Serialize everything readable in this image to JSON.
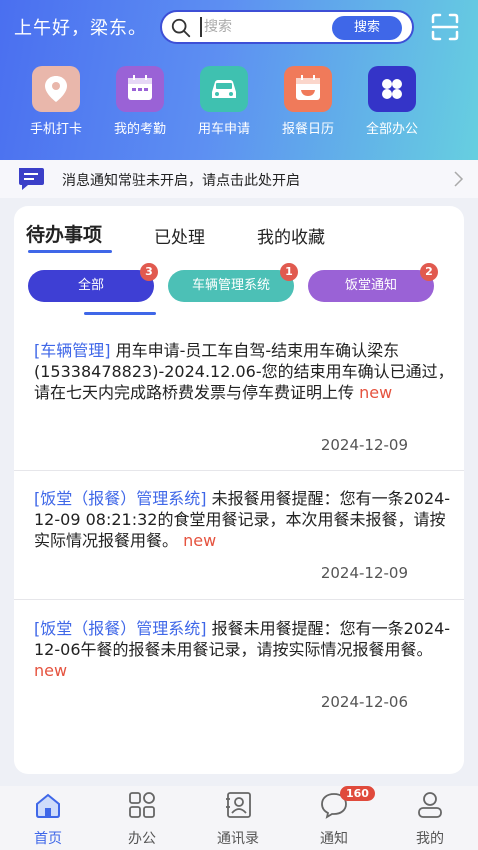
{
  "header": {
    "greeting": "上午好，梁东。",
    "search_placeholder": "搜索",
    "search_button": "搜索",
    "scan_icon": "scan-icon"
  },
  "quick_actions": [
    {
      "label": "手机打卡",
      "icon": "location-pin-icon",
      "color": "#e7b3a6"
    },
    {
      "label": "我的考勤",
      "icon": "calendar-icon",
      "color": "#9a62d6"
    },
    {
      "label": "用车申请",
      "icon": "car-icon",
      "color": "#3fc1b0"
    },
    {
      "label": "报餐日历",
      "icon": "meal-calendar-icon",
      "color": "#f07a5a"
    },
    {
      "label": "全部办公",
      "icon": "grid-apps-icon",
      "color": "#3f3fd0"
    }
  ],
  "notice": {
    "text": "消息通知常驻未开启，请点击此处开启"
  },
  "tabs": [
    "待办事项",
    "已处理",
    "我的收藏"
  ],
  "filters": [
    {
      "label": "全部",
      "count": "3",
      "color": "#3e3fd4"
    },
    {
      "label": "车辆管理系统",
      "count": "1",
      "color": "#4cc0b6"
    },
    {
      "label": "饭堂通知",
      "count": "2",
      "color": "#9a62d6"
    }
  ],
  "messages": [
    {
      "tag": "[车辆管理]",
      "body": " 用车申请-员工车自驾-结束用车确认梁东(15338478823)-2024.12.06-您的结束用车确认已通过，请在七天内完成路桥费发票与停车费证明上传 ",
      "new": "new",
      "date": "2024-12-09"
    },
    {
      "tag": "[饭堂（报餐）管理系统]",
      "body": " 未报餐用餐提醒：您有一条2024-12-09 08:21:32的食堂用餐记录，本次用餐未报餐，请按实际情况报餐用餐。 ",
      "new": "new",
      "date": "2024-12-09"
    },
    {
      "tag": "[饭堂（报餐）管理系统]",
      "body": " 报餐未用餐提醒：您有一条2024-12-06午餐的报餐未用餐记录，请按实际情况报餐用餐。 ",
      "new": "new",
      "date": "2024-12-06"
    }
  ],
  "tabbar": [
    {
      "label": "首页",
      "icon": "home-icon"
    },
    {
      "label": "办公",
      "icon": "apps-icon"
    },
    {
      "label": "通讯录",
      "icon": "contacts-icon"
    },
    {
      "label": "通知",
      "icon": "chat-bubble-icon",
      "badge": "160"
    },
    {
      "label": "我的",
      "icon": "person-icon"
    }
  ],
  "colors": {
    "accent": "#3f67e8",
    "new": "#e5533f",
    "badge": "#e15a4f"
  }
}
